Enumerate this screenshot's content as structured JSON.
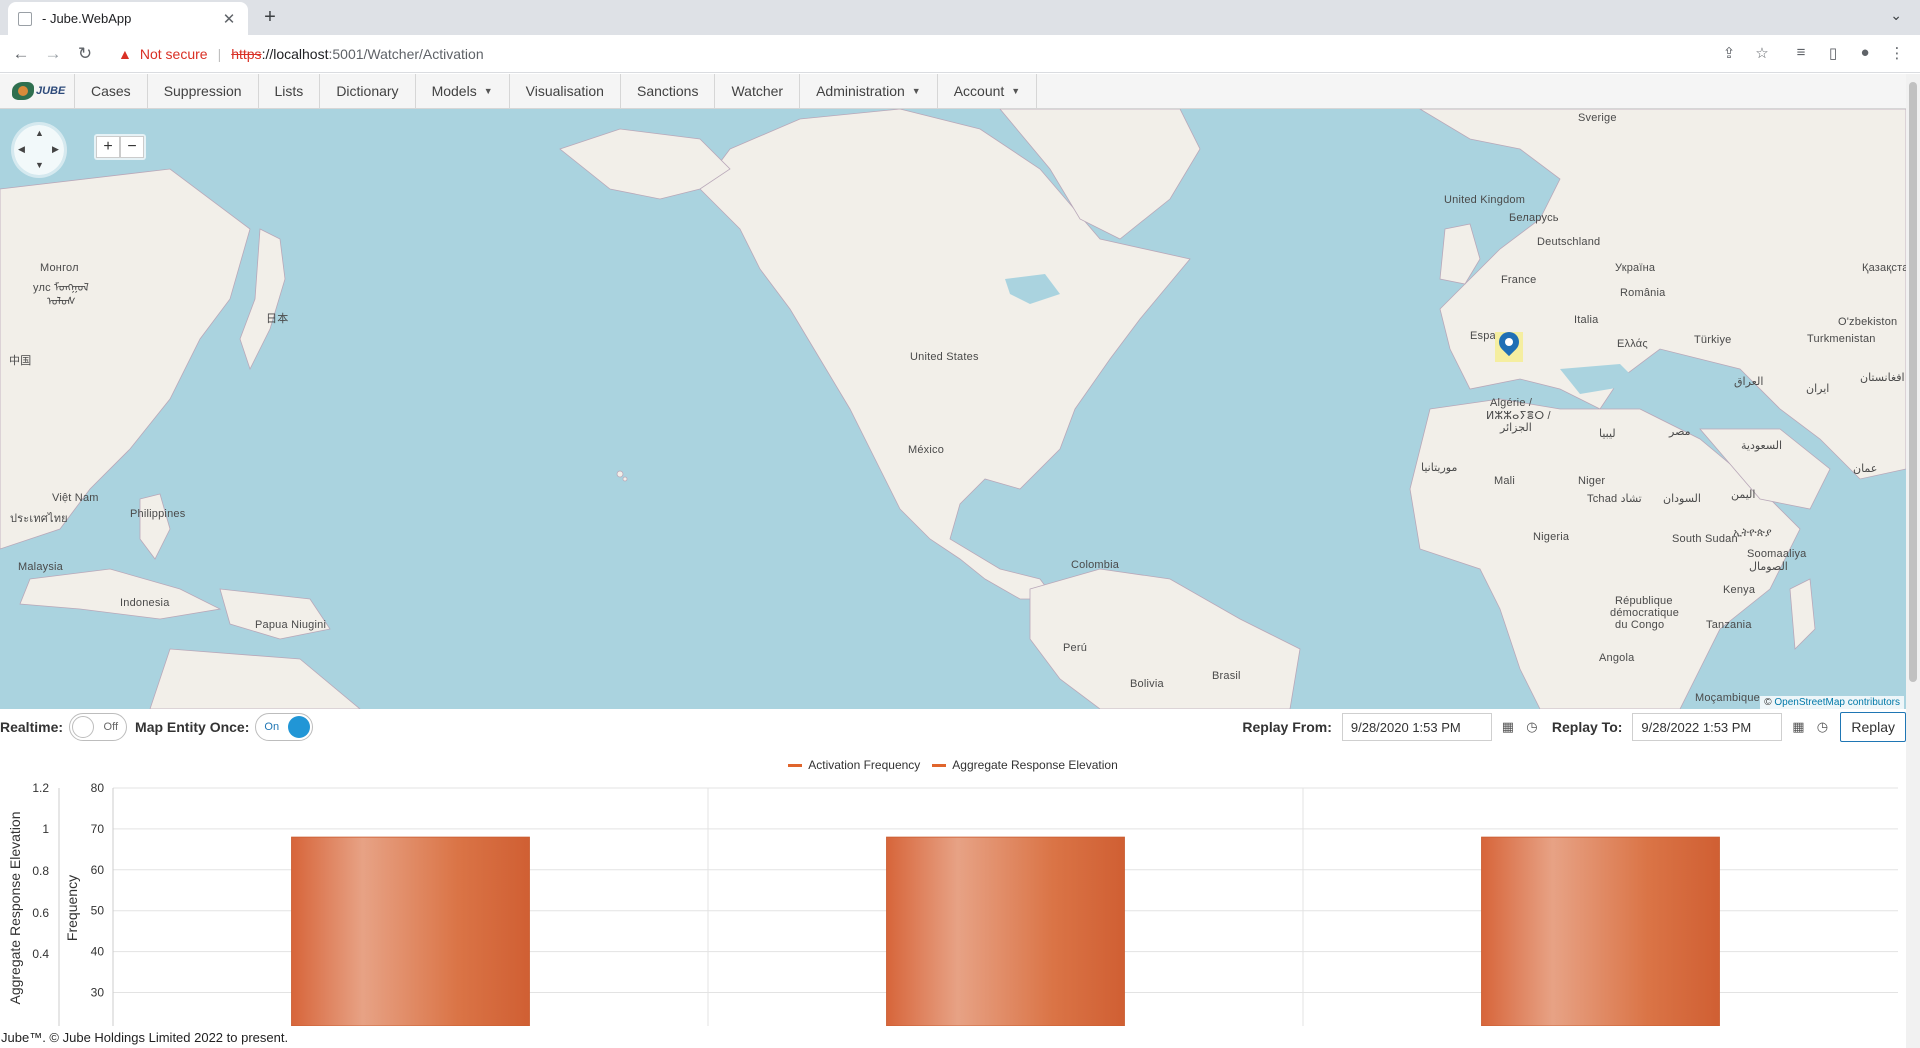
{
  "browser": {
    "tab_title": "- Jube.WebApp",
    "tab_close": "✕",
    "new_tab": "+",
    "tab_search": "⌄",
    "not_secure": "Not secure",
    "url_scheme": "https",
    "url_host": "://localhost",
    "url_path": ":5001/Watcher/Activation"
  },
  "nav": {
    "logo_text": "JUBE",
    "items": [
      {
        "label": "Cases",
        "dropdown": false
      },
      {
        "label": "Suppression",
        "dropdown": false
      },
      {
        "label": "Lists",
        "dropdown": false
      },
      {
        "label": "Dictionary",
        "dropdown": false
      },
      {
        "label": "Models",
        "dropdown": true
      },
      {
        "label": "Visualisation",
        "dropdown": false
      },
      {
        "label": "Sanctions",
        "dropdown": false
      },
      {
        "label": "Watcher",
        "dropdown": false
      },
      {
        "label": "Administration",
        "dropdown": true
      },
      {
        "label": "Account",
        "dropdown": true
      }
    ]
  },
  "map": {
    "zoom_in": "+",
    "zoom_out": "−",
    "attribution_prefix": "© ",
    "attribution_link": "OpenStreetMap contributors",
    "labels": [
      {
        "text": "Sverige"
      },
      {
        "text": "United Kingdom"
      },
      {
        "text": "Беларусь"
      },
      {
        "text": "Deutschland"
      },
      {
        "text": "Україна"
      },
      {
        "text": "Қазақста"
      },
      {
        "text": "France"
      },
      {
        "text": "România"
      },
      {
        "text": "Italia"
      },
      {
        "text": "O'zbekiston"
      },
      {
        "text": "Turkmenistan"
      },
      {
        "text": "Espa"
      },
      {
        "text": "Ελλάς"
      },
      {
        "text": "Türkiye"
      },
      {
        "text": "افغانستان"
      },
      {
        "text": "العراق"
      },
      {
        "text": "ایران"
      },
      {
        "text": "Algérie /"
      },
      {
        "text": "ⵍⵣⵣⴰⵢⴻⵔ /"
      },
      {
        "text": "الجزائر"
      },
      {
        "text": "ليبيا"
      },
      {
        "text": "مصر"
      },
      {
        "text": "السعودية"
      },
      {
        "text": "عمان"
      },
      {
        "text": "موريتانيا"
      },
      {
        "text": "Mali"
      },
      {
        "text": "Niger"
      },
      {
        "text": "Tchad تشاد"
      },
      {
        "text": "السودان"
      },
      {
        "text": "اليمن"
      },
      {
        "text": "South Sudan"
      },
      {
        "text": "ኢትዮጵያ"
      },
      {
        "text": "Soomaaliya"
      },
      {
        "text": "الصومال"
      },
      {
        "text": "Nigeria"
      },
      {
        "text": "Kenya"
      },
      {
        "text": "République"
      },
      {
        "text": "démocratique"
      },
      {
        "text": "du Congo"
      },
      {
        "text": "Tanzania"
      },
      {
        "text": "Angola"
      },
      {
        "text": "Moçambique"
      },
      {
        "text": "United States"
      },
      {
        "text": "México"
      },
      {
        "text": "Colombia"
      },
      {
        "text": "Perú"
      },
      {
        "text": "Bolivia"
      },
      {
        "text": "Brasil"
      },
      {
        "text": "Монгол"
      },
      {
        "text": "улс ᠮᠣᠩᠭᠣᠯ"
      },
      {
        "text": "ᠤᠯᠤᠰ"
      },
      {
        "text": "日本"
      },
      {
        "text": "中国"
      },
      {
        "text": "Việt Nam"
      },
      {
        "text": "Philippines"
      },
      {
        "text": "ประเทศไทย"
      },
      {
        "text": "Malaysia"
      },
      {
        "text": "Indonesia"
      },
      {
        "text": "Papua Niugini"
      }
    ]
  },
  "controls": {
    "realtime_label": "Realtime:",
    "realtime_state": "Off",
    "map_entity_label": "Map Entity Once:",
    "map_entity_state": "On",
    "replay_from_label": "Replay From:",
    "replay_from_value": "9/28/2020 1:53 PM",
    "replay_to_label": "Replay To:",
    "replay_to_value": "9/28/2022 1:53 PM",
    "replay_button": "Replay"
  },
  "chart_data": {
    "type": "bar",
    "series": [
      {
        "name": "Activation Frequency",
        "color": "#e0652c"
      },
      {
        "name": "Aggregate Response Elevation",
        "color": "#e0652c"
      }
    ],
    "categories": [
      "",
      "",
      ""
    ],
    "values": [
      68,
      68,
      68
    ],
    "left_axis_title": "Aggregate Response Elevation",
    "left_axis_ticks": [
      "1.2",
      "1",
      "0.8",
      "0.6",
      "0.4"
    ],
    "right_axis_title": "Frequency",
    "right_axis_ticks": [
      "80",
      "70",
      "60",
      "50",
      "40",
      "30"
    ],
    "ylim": [
      25,
      80
    ],
    "grid": true
  },
  "footer": {
    "text": "Jube™. © Jube Holdings Limited 2022 to present."
  }
}
